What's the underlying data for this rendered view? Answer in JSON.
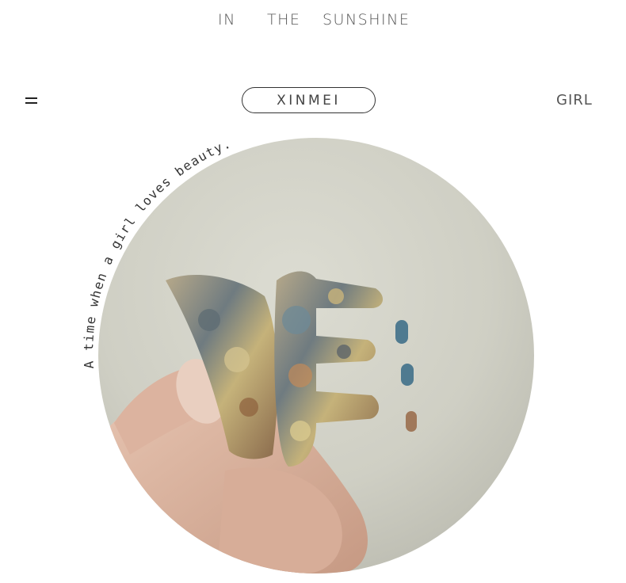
{
  "header": {
    "tagline": [
      "IN",
      "THE",
      "SUNSHINE"
    ],
    "brand": "XINMEI",
    "right_label": "GIRL",
    "menu_icon": "hamburger-menu-icon"
  },
  "photo": {
    "arc_caption": "A time when a girl loves beauty."
  }
}
